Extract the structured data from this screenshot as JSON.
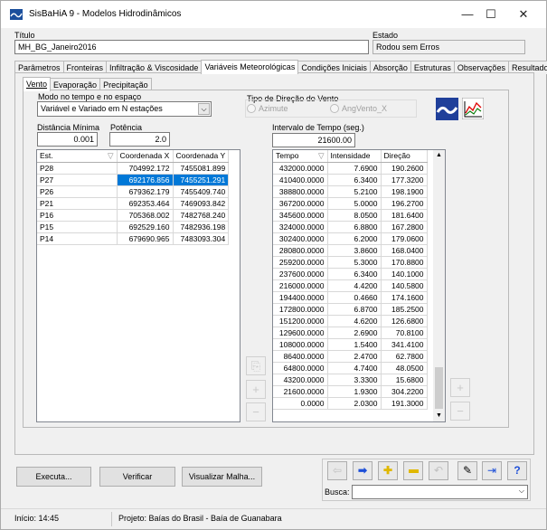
{
  "window": {
    "title": "SisBaHiA 9 - Modelos Hidrodinâmicos",
    "minimize": "—",
    "maximize": "☐",
    "close": "✕"
  },
  "header": {
    "titulo_label": "Título",
    "titulo_value": "MH_BG_Janeiro2016",
    "estado_label": "Estado",
    "estado_value": "Rodou sem Erros"
  },
  "main_tabs": [
    "Parâmetros",
    "Fronteiras",
    "Infiltração & Viscosidade",
    "Variáveis Meteorológicas",
    "Condições Iniciais",
    "Absorção",
    "Estruturas",
    "Observações",
    "Resultados"
  ],
  "sub_tabs": [
    "Vento",
    "Evaporação",
    "Precipitação"
  ],
  "vento": {
    "modo_label": "Modo no tempo e no espaço",
    "modo_value": "Variável e Variado em N estações",
    "tipo_label": "Tipo de Direção do Vento",
    "radio_azimute": "Azimute",
    "radio_angvento": "AngVento_X",
    "dist_label": "Distância Mínima",
    "dist_value": "0.001",
    "potencia_label": "Potência",
    "potencia_value": "2.0",
    "intervalo_label": "Intervalo de Tempo (seg.)",
    "intervalo_value": "21600.00"
  },
  "stations": {
    "headers": [
      "Est.",
      "Coordenada X",
      "Coordenada Y"
    ],
    "rows": [
      [
        "P28",
        "704992.172",
        "7455081.899"
      ],
      [
        "P27",
        "692176.856",
        "7455251.291"
      ],
      [
        "P26",
        "679362.179",
        "7455409.740"
      ],
      [
        "P21",
        "692353.464",
        "7469093.842"
      ],
      [
        "P16",
        "705368.002",
        "7482768.240"
      ],
      [
        "P15",
        "692529.160",
        "7482936.198"
      ],
      [
        "P14",
        "679690.965",
        "7483093.304"
      ]
    ]
  },
  "series": {
    "headers": [
      "Tempo",
      "Intensidade",
      "Direção"
    ],
    "rows": [
      [
        "432000.0000",
        "7.6900",
        "190.2600"
      ],
      [
        "410400.0000",
        "6.3400",
        "177.3200"
      ],
      [
        "388800.0000",
        "5.2100",
        "198.1900"
      ],
      [
        "367200.0000",
        "5.0000",
        "196.2700"
      ],
      [
        "345600.0000",
        "8.0500",
        "181.6400"
      ],
      [
        "324000.0000",
        "6.8800",
        "167.2800"
      ],
      [
        "302400.0000",
        "6.2000",
        "179.0600"
      ],
      [
        "280800.0000",
        "3.8600",
        "168.0400"
      ],
      [
        "259200.0000",
        "5.3000",
        "170.8800"
      ],
      [
        "237600.0000",
        "6.3400",
        "140.1000"
      ],
      [
        "216000.0000",
        "4.4200",
        "140.5800"
      ],
      [
        "194400.0000",
        "0.4660",
        "174.1600"
      ],
      [
        "172800.0000",
        "6.8700",
        "185.2500"
      ],
      [
        "151200.0000",
        "4.6200",
        "126.6800"
      ],
      [
        "129600.0000",
        "2.6900",
        "70.8100"
      ],
      [
        "108000.0000",
        "1.5400",
        "341.4100"
      ],
      [
        "86400.0000",
        "2.4700",
        "62.7800"
      ],
      [
        "64800.0000",
        "4.7400",
        "48.0500"
      ],
      [
        "43200.0000",
        "3.3300",
        "15.6800"
      ],
      [
        "21600.0000",
        "1.9300",
        "304.2200"
      ],
      [
        "0.0000",
        "2.0300",
        "191.3000"
      ]
    ]
  },
  "buttons": {
    "executa": "Executa...",
    "verificar": "Verificar",
    "visualizar": "Visualizar Malha..."
  },
  "busca_label": "Busca:",
  "status": {
    "inicio": "Início: 14:45",
    "projeto": "Projeto: Baías do Brasil - Baía de Guanabara"
  }
}
